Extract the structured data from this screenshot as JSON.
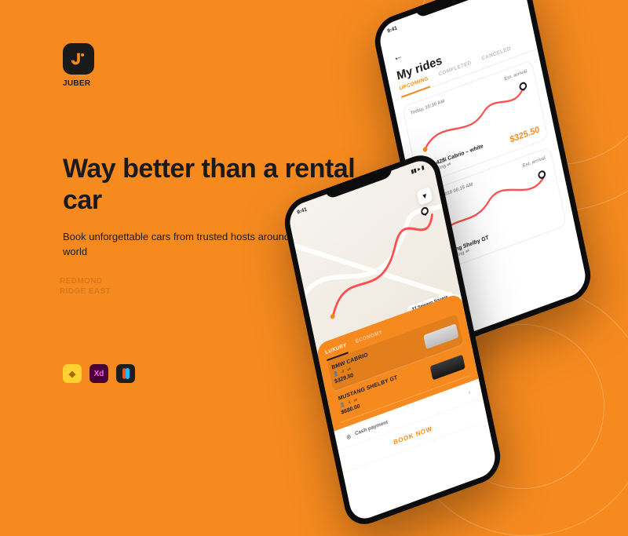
{
  "brand": "JUBER",
  "headline": "Way better than a rental car",
  "sub": "Book unforgettable cars from trusted hosts around the world",
  "bg_map_labels": [
    "REDMOND",
    "RIDGE EAST"
  ],
  "tool_icons": {
    "sketch": "sketch",
    "xd": "Xd",
    "figma": "figma"
  },
  "phone_rides": {
    "status_time": "9:41",
    "title": "My rides",
    "tabs": {
      "upcoming": "UPCOMING",
      "completed": "COMPLETED",
      "canceled": "CANCELED"
    },
    "cards": [
      {
        "when": "Today, 10:30 AM",
        "est": "Est. arrival",
        "car": "BMW 428i Cabrio – white",
        "carsharing_label": "carsharing",
        "price": "$325.50"
      },
      {
        "when": "Aug 8 2018 06:15 AM",
        "est": "Est. arrival",
        "car": "Mustang Shelby GT",
        "carsharing_label": "carsharing",
        "price": ""
      }
    ]
  },
  "phone_book": {
    "status_time": "9:41",
    "address": "27 Sawayn Square",
    "category_tabs": {
      "luxury": "LUXURY",
      "economy": "ECONOMY"
    },
    "cars": [
      {
        "name": "BMW CABRIO",
        "passengers": "4",
        "price": "$329.50"
      },
      {
        "name": "MUSTANG SHELBY GT",
        "passengers": "4",
        "price": "$680.00"
      }
    ],
    "payment": {
      "label": "Cash payment",
      "icon": "wallet"
    },
    "cta": "BOOK NOW"
  },
  "colors": {
    "accent": "#f68a1f",
    "ink": "#1a1a1a"
  }
}
